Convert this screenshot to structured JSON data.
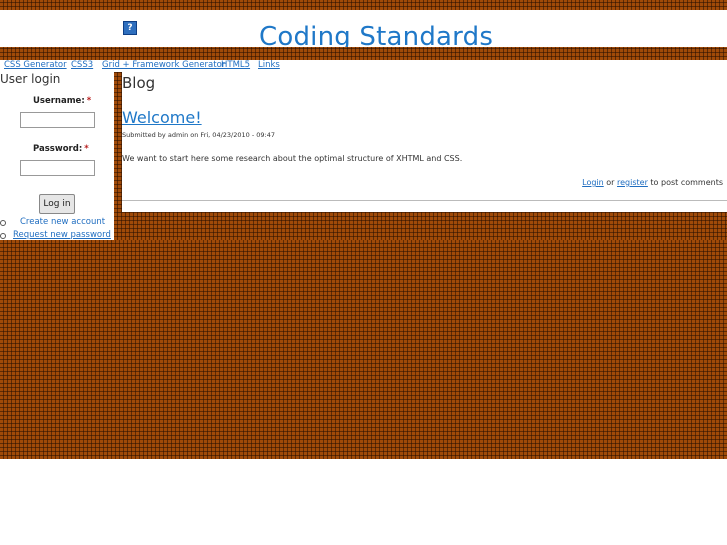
{
  "header": {
    "site_title": "Coding Standards",
    "help_icon": "?"
  },
  "nav": {
    "items": [
      {
        "label": "CSS Generator"
      },
      {
        "label": "CSS3"
      },
      {
        "label": "Grid + Framework Generator"
      },
      {
        "label": "HTML5"
      },
      {
        "label": "Links"
      }
    ]
  },
  "login": {
    "title": "User login",
    "username_label": "Username:",
    "password_label": "Password:",
    "required_marker": "*",
    "username_value": "",
    "password_value": "",
    "button_label": "Log in",
    "create_account": "Create new account",
    "request_password": "Request new password"
  },
  "main": {
    "heading": "Blog",
    "post": {
      "title": "Welcome!",
      "meta": "Submitted by admin on Fri, 04/23/2010 - 09:47",
      "body": "We want to start here some research about the optimal structure of XHTML and CSS.",
      "login_link": "Login",
      "or_text": "or",
      "register_link": "register",
      "comments_suffix": "to post comments"
    }
  },
  "colors": {
    "brick": "#a04a08",
    "link": "#1f6dc0",
    "title": "#1f78c8"
  }
}
